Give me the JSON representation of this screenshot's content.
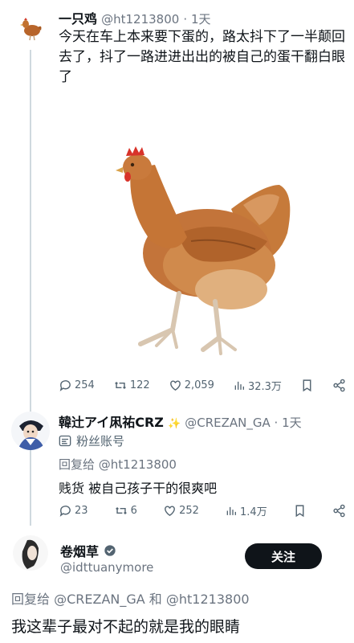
{
  "tweet1": {
    "author_name": "一只鸡",
    "handle": "@ht1213800",
    "time": "· 1天",
    "text": "今天在车上本来要下蛋的，路太抖下了一半颠回去了，抖了一路进进出出的被自己的蛋干翻白眼了",
    "media_icon": "chicken-photo",
    "actions": {
      "replies": "254",
      "retweets": "122",
      "likes": "2,059",
      "views": "32.3万"
    }
  },
  "tweet2": {
    "author_name": "韓辻アイ凩祐CRZ",
    "handle": "@CREZAN_GA · 1天",
    "badge_label": "粉丝账号",
    "reply_to": "回复给 @ht1213800",
    "text": "贱货 被自己孩子干的很爽吧",
    "actions": {
      "replies": "23",
      "retweets": "6",
      "likes": "252",
      "views": "1.4万"
    }
  },
  "tweet3": {
    "author_name": "卷烟草",
    "handle": "@idttuanymore",
    "follow_label": "关注",
    "reply_to": "回复给 @CREZAN_GA 和 @ht1213800",
    "text": "我这辈子最对不起的就是我的眼睛"
  },
  "colors": {
    "text": "#0f1419",
    "muted": "#6b7480",
    "thread_line": "#cfd9de",
    "follow_button": "#0f1419"
  }
}
